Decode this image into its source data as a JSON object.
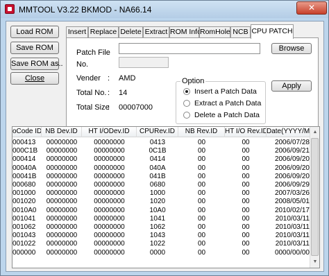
{
  "window": {
    "title": "MMTOOL V3.22 BKMOD  -  NA66.14",
    "close_glyph": "✕"
  },
  "side_buttons": {
    "load": "Load ROM",
    "save": "Save ROM",
    "save_as": "Save ROM as..",
    "close": "Close"
  },
  "tabs": [
    {
      "label": "Insert"
    },
    {
      "label": "Replace"
    },
    {
      "label": "Delete"
    },
    {
      "label": "Extract"
    },
    {
      "label": "ROM Info"
    },
    {
      "label": "RomHole"
    },
    {
      "label": "NCB"
    },
    {
      "label": "CPU PATCH",
      "active": true
    }
  ],
  "patch": {
    "patch_file_label": "Patch File",
    "patch_file_value": "",
    "no_label": "No.",
    "no_value": "",
    "browse": "Browse",
    "apply": "Apply",
    "vender_label": "Vender",
    "vender_value": "AMD",
    "total_no_label": "Total No.",
    "total_no_value": "14",
    "total_size_label": "Total Size",
    "total_size_value": "00007000",
    "colon": ":"
  },
  "option": {
    "title": "Option",
    "choices": [
      {
        "label": "Insert a Patch Data",
        "checked": true
      },
      {
        "label": "Extract a Patch Data",
        "checked": false
      },
      {
        "label": "Delete a Patch Data",
        "checked": false
      }
    ]
  },
  "table": {
    "columns": [
      "oCode ID",
      "NB Dev.ID",
      "HT I/ODev.ID",
      "CPURev.ID",
      "NB Rev.ID",
      "HT I/O Rev.ID",
      "Date(YYYY/MM/DD)"
    ],
    "rows": [
      [
        "000413",
        "00000000",
        "00000000",
        "0413",
        "00",
        "00",
        "2006/07/28"
      ],
      [
        "000C1B",
        "00000000",
        "00000000",
        "0C1B",
        "00",
        "00",
        "2006/09/21"
      ],
      [
        "000414",
        "00000000",
        "00000000",
        "0414",
        "00",
        "00",
        "2006/09/20"
      ],
      [
        "00040A",
        "00000000",
        "00000000",
        "040A",
        "00",
        "00",
        "2006/09/20"
      ],
      [
        "00041B",
        "00000000",
        "00000000",
        "041B",
        "00",
        "00",
        "2006/09/20"
      ],
      [
        "000680",
        "00000000",
        "00000000",
        "0680",
        "00",
        "00",
        "2006/09/29"
      ],
      [
        "001000",
        "00000000",
        "00000000",
        "1000",
        "00",
        "00",
        "2007/03/26"
      ],
      [
        "001020",
        "00000000",
        "00000000",
        "1020",
        "00",
        "00",
        "2008/05/01"
      ],
      [
        "0010A0",
        "00000000",
        "00000000",
        "10A0",
        "00",
        "00",
        "2010/02/17"
      ],
      [
        "001041",
        "00000000",
        "00000000",
        "1041",
        "00",
        "00",
        "2010/03/11"
      ],
      [
        "001062",
        "00000000",
        "00000000",
        "1062",
        "00",
        "00",
        "2010/03/11"
      ],
      [
        "001043",
        "00000000",
        "00000000",
        "1043",
        "00",
        "00",
        "2010/03/11"
      ],
      [
        "001022",
        "00000000",
        "00000000",
        "1022",
        "00",
        "00",
        "2010/03/11"
      ],
      [
        "000000",
        "00000000",
        "00000000",
        "0000",
        "00",
        "00",
        "0000/00/00"
      ]
    ]
  },
  "scrollbar": {
    "up_icon": "▲",
    "down_icon": "▼"
  }
}
